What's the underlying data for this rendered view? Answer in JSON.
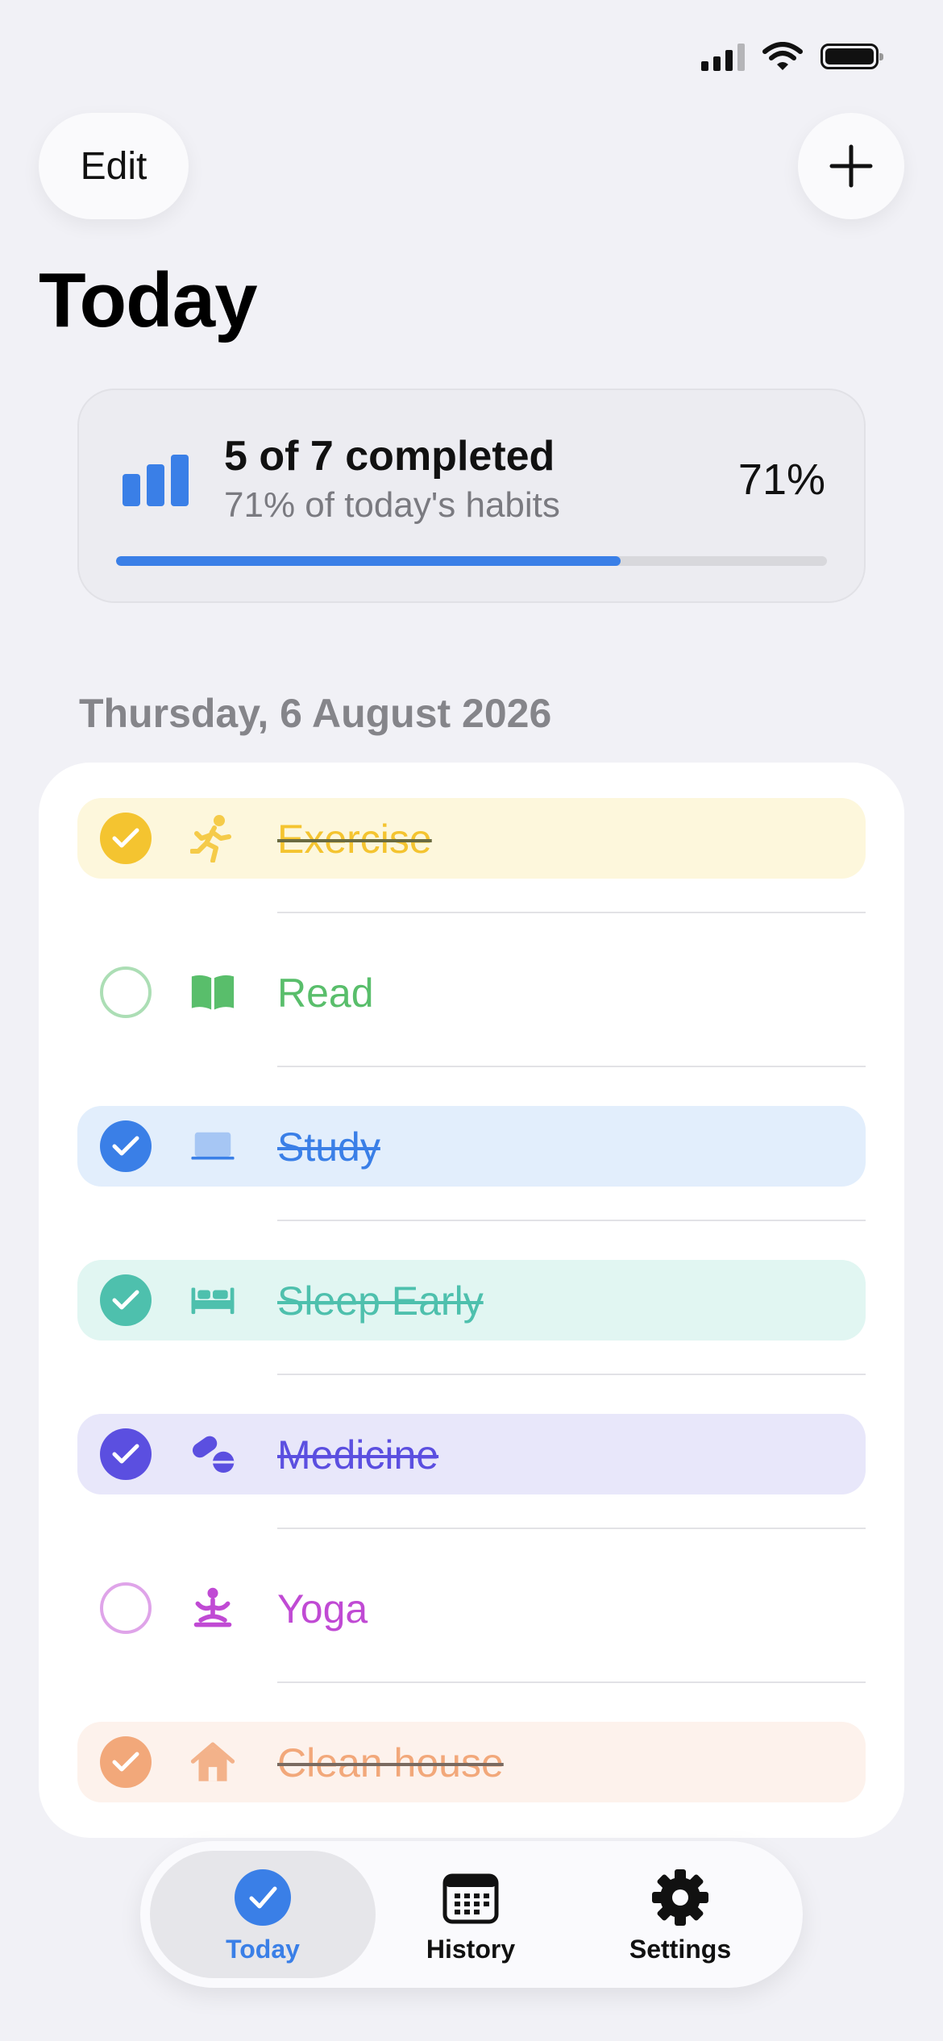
{
  "header": {
    "edit_label": "Edit",
    "add_icon": "plus-icon",
    "title": "Today"
  },
  "progress": {
    "headline": "5 of 7 completed",
    "subtitle": "71% of today's habits",
    "percent_label": "71%",
    "fraction": 0.71,
    "icon": "bar-chart-icon",
    "accent": "#3a7fe7"
  },
  "date_label": "Thursday, 6 August 2026",
  "habits": [
    {
      "name": "Exercise",
      "done": true,
      "icon": "running-icon",
      "color": "#f4c430",
      "tint": "#fdf7dc"
    },
    {
      "name": "Read",
      "done": false,
      "icon": "book-icon",
      "color": "#59be6b",
      "tint": "#ffffff"
    },
    {
      "name": "Study",
      "done": true,
      "icon": "laptop-icon",
      "color": "#3a7fe7",
      "tint": "#e2eefc"
    },
    {
      "name": "Sleep Early",
      "done": true,
      "icon": "bed-icon",
      "color": "#4ec0ad",
      "tint": "#e1f6f2"
    },
    {
      "name": "Medicine",
      "done": true,
      "icon": "pills-icon",
      "color": "#5b4fe0",
      "tint": "#e8e7fa"
    },
    {
      "name": "Yoga",
      "done": false,
      "icon": "yoga-icon",
      "color": "#c04ad4",
      "tint": "#ffffff"
    },
    {
      "name": "Clean house",
      "done": true,
      "icon": "house-icon",
      "color": "#f2a87a",
      "tint": "#fdf2ec"
    }
  ],
  "tabs": [
    {
      "label": "Today",
      "icon": "checkmark-circle-icon",
      "active": true
    },
    {
      "label": "History",
      "icon": "calendar-icon",
      "active": false
    },
    {
      "label": "Settings",
      "icon": "gear-icon",
      "active": false
    }
  ]
}
